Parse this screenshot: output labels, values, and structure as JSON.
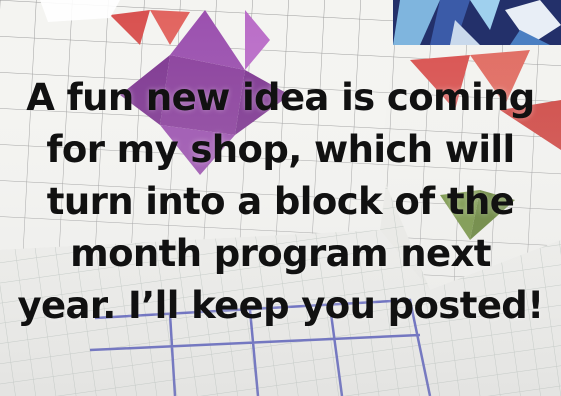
{
  "caption": {
    "lines": [
      "A fun new idea is coming",
      "for my shop, which will",
      "turn into a block of the",
      "month program next",
      "year. I’ll keep you posted!"
    ]
  },
  "palette": {
    "quilt_purple": "#8a3f9c",
    "quilt_red": "#d8504e",
    "quilt_green": "#6f8f3a",
    "grid_blue": "#4a4fb8",
    "paper": "#f2f2ef",
    "fabric_navy": "#23306a",
    "fabric_light_blue": "#7fb5de"
  }
}
